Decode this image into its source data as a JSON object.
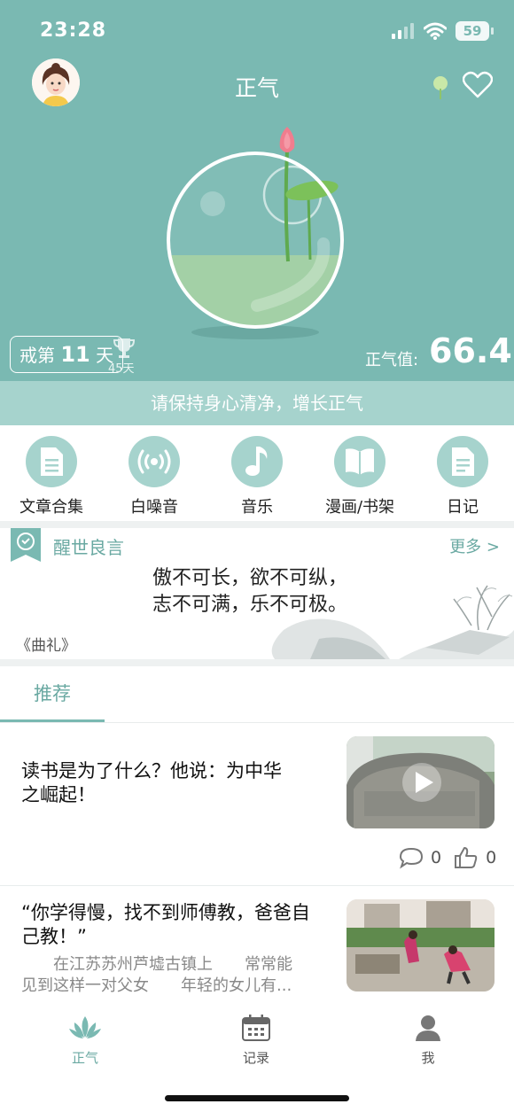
{
  "status_bar": {
    "time": "23:28",
    "battery": "59"
  },
  "header": {
    "title": "正气"
  },
  "hero": {
    "streak_prefix": "戒第",
    "streak_days": "11",
    "streak_suffix": "天",
    "best_days": "45天",
    "score_label": "正气值:",
    "score_value": "66.4",
    "slogan": "请保持身心清净，增长正气"
  },
  "quick_nav": [
    {
      "label": "文章合集",
      "icon": "document-icon"
    },
    {
      "label": "白噪音",
      "icon": "broadcast-icon"
    },
    {
      "label": "音乐",
      "icon": "music-note-icon"
    },
    {
      "label": "漫画/书架",
      "icon": "open-book-icon"
    },
    {
      "label": "日记",
      "icon": "notes-icon"
    }
  ],
  "quote": {
    "section_title": "醒世良言",
    "more": "更多 >",
    "line1": "傲不可长，欲不可纵，",
    "line2": "志不可满，乐不可极。",
    "source": "《曲礼》"
  },
  "tabs": {
    "recommend": "推荐"
  },
  "articles": [
    {
      "title_line1": "读书是为了什么？他说：为中华",
      "title_line2": "之崛起！",
      "comments": "0",
      "likes": "0"
    },
    {
      "title_line1": "“你学得慢，找不到师傅教，爸爸自",
      "title_line2": "己教！”",
      "summary_line1": "　　在江苏苏州芦墟古镇上　　常常能",
      "summary_line2": "见到这样一对父女　　年轻的女儿有..."
    }
  ],
  "tabbar": {
    "items": [
      {
        "label": "正气",
        "active": true
      },
      {
        "label": "记录",
        "active": false
      },
      {
        "label": "我",
        "active": false
      }
    ],
    "active_color": "#6aa9a2",
    "inactive_color": "#555555"
  },
  "colors": {
    "brand": "#7ab9b2",
    "brand_light": "#a6d3cd"
  }
}
